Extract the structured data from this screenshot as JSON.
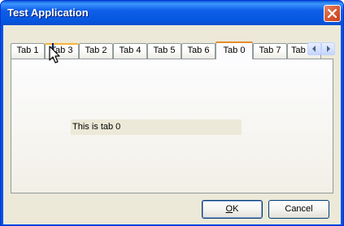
{
  "window": {
    "title": "Test Application"
  },
  "tabs": [
    {
      "label": "Tab 1",
      "state": "normal"
    },
    {
      "label": "Tab 3",
      "state": "hot"
    },
    {
      "label": "Tab 2",
      "state": "normal"
    },
    {
      "label": "Tab 4",
      "state": "normal"
    },
    {
      "label": "Tab 5",
      "state": "normal"
    },
    {
      "label": "Tab 6",
      "state": "normal"
    },
    {
      "label": "Tab 0",
      "state": "selected"
    },
    {
      "label": "Tab 7",
      "state": "normal"
    },
    {
      "label": "Tab",
      "state": "partial"
    }
  ],
  "panel": {
    "text": "This is tab 0"
  },
  "buttons": {
    "ok": {
      "mnemonic": "O",
      "rest": "K"
    },
    "cancel": "Cancel"
  },
  "icons": {
    "close": "close-icon",
    "scroll_left": "scroll-left-icon",
    "scroll_right": "scroll-right-icon",
    "cursor": "mouse-cursor-icon"
  },
  "colors": {
    "titlebar": "#0054e3",
    "selected_tab_accent": "#e68b2c",
    "hot_tab_accent": "#f8b33c"
  }
}
